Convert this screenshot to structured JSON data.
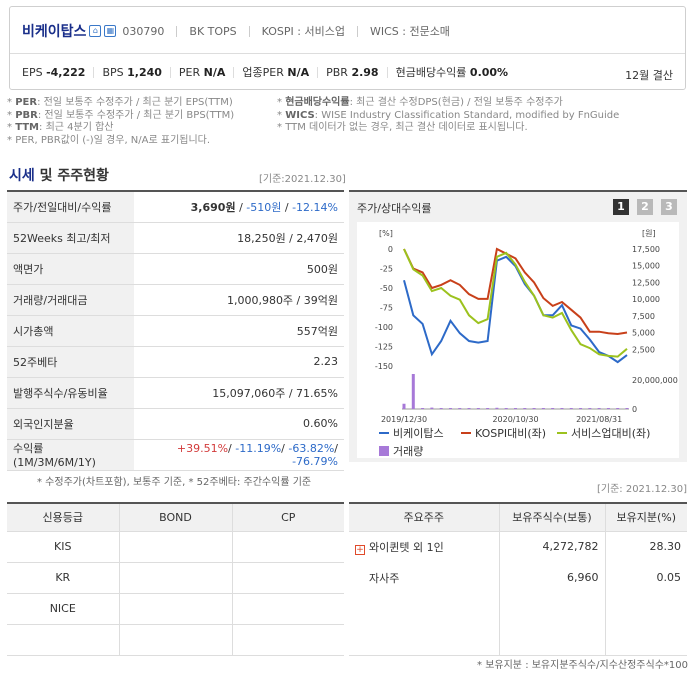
{
  "header": {
    "company": "비케이탑스",
    "code": "030790",
    "tags": [
      "BK TOPS",
      "KOSPI : 서비스업",
      "WICS : 전문소매"
    ],
    "metrics": [
      {
        "label": "EPS",
        "value": "-4,222"
      },
      {
        "label": "BPS",
        "value": "1,240"
      },
      {
        "label": "PER",
        "value": "N/A"
      },
      {
        "label": "업종PER",
        "value": "N/A"
      },
      {
        "label": "PBR",
        "value": "2.98"
      },
      {
        "label": "현금배당수익률",
        "value": "0.00%"
      }
    ],
    "fiscal": "12월 결산"
  },
  "notes": {
    "left": [
      {
        "k": "PER",
        "t": ": 전일 보통주 수정주가 / 최근 분기 EPS(TTM)"
      },
      {
        "k": "PBR",
        "t": ": 전일 보통주 수정주가 / 최근 분기 BPS(TTM)"
      },
      {
        "k": "TTM",
        "t": ": 최근 4분기 합산"
      },
      {
        "k": "",
        "t": "PER, PBR값이 (-)일 경우, N/A로 표기됩니다."
      }
    ],
    "right": [
      {
        "k": "현금배당수익률",
        "t": ": 최근 결산 수정DPS(현금) / 전일 보통주 수정주가"
      },
      {
        "k": "WICS",
        "t": ": WISE Industry Classification Standard, modified by FnGuide"
      },
      {
        "k": "",
        "t": "TTM 데이터가 없는 경우, 최근 결산 데이터로 표시됩니다."
      }
    ]
  },
  "section": {
    "title_a": "시세",
    "title_b": " 및 주주현황",
    "basedate": "[기준:2021.12.30]"
  },
  "market": [
    {
      "k": "주가/전일대비/수익률",
      "v": [
        {
          "t": "3,690원",
          "c": "bold"
        },
        {
          "t": " / ",
          "c": ""
        },
        {
          "t": "-510원",
          "c": "blue"
        },
        {
          "t": " / ",
          "c": ""
        },
        {
          "t": "-12.14%",
          "c": "blue"
        }
      ]
    },
    {
      "k": "52Weeks 최고/최저",
      "v": [
        {
          "t": "18,250원 / 2,470원",
          "c": ""
        }
      ]
    },
    {
      "k": "액면가",
      "v": [
        {
          "t": "500원",
          "c": ""
        }
      ]
    },
    {
      "k": "거래량/거래대금",
      "v": [
        {
          "t": "1,000,980주 / 39억원",
          "c": ""
        }
      ]
    },
    {
      "k": "시가총액",
      "v": [
        {
          "t": "557억원",
          "c": ""
        }
      ]
    },
    {
      "k": "52주베타",
      "v": [
        {
          "t": "2.23",
          "c": ""
        }
      ]
    },
    {
      "k": "발행주식수/유동비율",
      "v": [
        {
          "t": "15,097,060주 / 71.65%",
          "c": ""
        }
      ]
    },
    {
      "k": "외국인지분율",
      "v": [
        {
          "t": "0.60%",
          "c": ""
        }
      ]
    },
    {
      "k": "수익률 (1M/3M/6M/1Y)",
      "v": [
        {
          "t": "+39.51%",
          "c": "red"
        },
        {
          "t": "/ ",
          "c": ""
        },
        {
          "t": "-11.19%",
          "c": "blue"
        },
        {
          "t": "/ ",
          "c": ""
        },
        {
          "t": "-63.82%",
          "c": "blue"
        },
        {
          "t": "/ ",
          "c": ""
        },
        {
          "t": "-76.79%",
          "c": "blue"
        }
      ]
    }
  ],
  "market_note": "* 수정주가(차트포함), 보통주 기준, * 52주베타: 주간수익률 기준",
  "chart_panel": {
    "title": "주가/상대수익률",
    "pages": [
      "1",
      "2",
      "3"
    ]
  },
  "chart_data": {
    "type": "line",
    "y_left_unit": "[%]",
    "y_left_ticks": [
      "0",
      "-25",
      "-50",
      "-75",
      "-100",
      "-125",
      "-150"
    ],
    "y_left_range": [
      -150,
      0
    ],
    "y_right_unit": "[원]",
    "y_right_ticks": [
      "17,500",
      "15,000",
      "12,500",
      "10,000",
      "7,500",
      "5,000",
      "2,500"
    ],
    "y_right_range": [
      0,
      17500
    ],
    "vol_ticks": [
      "20,000,000",
      "0"
    ],
    "vol_range": [
      0,
      20000000
    ],
    "x_ticks": [
      "2019/12/30",
      "2020/10/30",
      "2021/08/31"
    ],
    "x_count": 25,
    "series": [
      {
        "name": "비케이탑스",
        "color": "#2d6ac8",
        "values": [
          -40,
          -85,
          -96,
          -135,
          -118,
          -92,
          -108,
          -118,
          -120,
          -118,
          -15,
          -10,
          -22,
          -45,
          -60,
          -85,
          -85,
          -72,
          -98,
          -102,
          -116,
          -132,
          -137,
          -145,
          -136
        ]
      },
      {
        "name": "KOSPI대비(좌)",
        "color": "#c8401a",
        "values": [
          0,
          -25,
          -30,
          -50,
          -46,
          -40,
          -46,
          -58,
          -64,
          -64,
          0,
          -6,
          -12,
          -30,
          -43,
          -63,
          -73,
          -68,
          -78,
          -88,
          -106,
          -106,
          -108,
          -109,
          -107
        ]
      },
      {
        "name": "서비스업대비(좌)",
        "color": "#9cc21e",
        "values": [
          0,
          -26,
          -34,
          -54,
          -50,
          -60,
          -65,
          -85,
          -95,
          -90,
          -10,
          -5,
          -20,
          -42,
          -60,
          -85,
          -88,
          -82,
          -104,
          -122,
          -127,
          -135,
          -137,
          -138,
          -128
        ]
      }
    ],
    "volume": {
      "name": "거래량",
      "color": "#a779d8",
      "values": [
        3000000,
        28000000,
        500000,
        800000,
        300000,
        200000,
        200000,
        150000,
        200000,
        300000,
        700000,
        400000,
        300000,
        500000,
        400000,
        300000,
        300000,
        200000,
        300000,
        200000,
        300000,
        400000,
        300000,
        200000,
        300000
      ]
    }
  },
  "credit": {
    "headers": [
      "신용등급",
      "BOND",
      "CP"
    ],
    "rows": [
      [
        "KIS",
        "",
        ""
      ],
      [
        "KR",
        "",
        ""
      ],
      [
        "NICE",
        "",
        ""
      ],
      [
        "",
        "",
        ""
      ]
    ]
  },
  "holders": {
    "basedate": "[기준: 2021.12.30]",
    "headers": [
      "주요주주",
      "보유주식수(보통)",
      "보유지분(%)"
    ],
    "rows": [
      {
        "name": "와이퀸텟 외 1인",
        "shares": "4,272,782",
        "pct": "28.30",
        "expand": true
      },
      {
        "name": "자사주",
        "shares": "6,960",
        "pct": "0.05",
        "expand": false
      },
      {
        "name": "",
        "shares": "",
        "pct": "",
        "expand": false
      },
      {
        "name": "",
        "shares": "",
        "pct": "",
        "expand": false
      }
    ],
    "note": "* 보유지분 : 보유지분주식수/지수산정주식수*100"
  }
}
